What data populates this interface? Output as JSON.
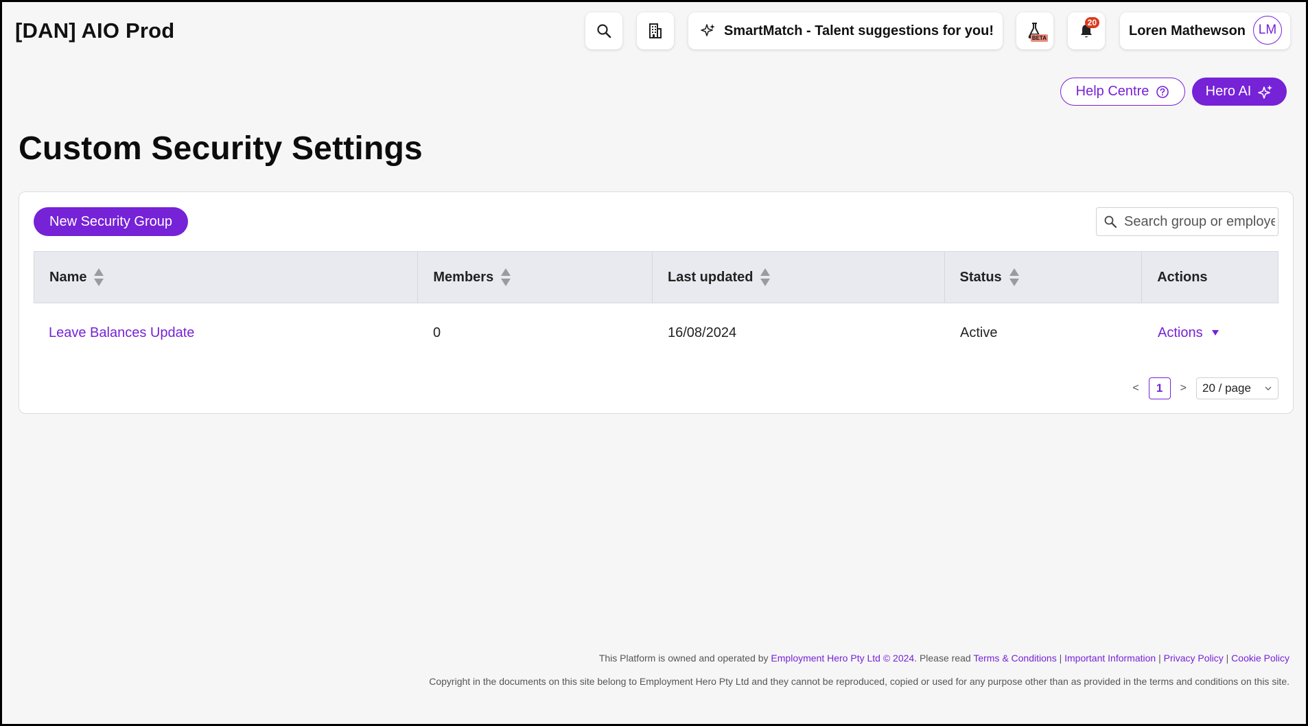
{
  "header": {
    "org_title": "[DAN] AIO Prod",
    "smartmatch_label": "SmartMatch - Talent suggestions for you!",
    "beta_label": "BETA",
    "notification_count": "20",
    "user_name": "Loren Mathewson",
    "user_initials": "LM"
  },
  "actions_bar": {
    "help_label": "Help Centre",
    "hero_ai_label": "Hero AI"
  },
  "page": {
    "title": "Custom Security Settings"
  },
  "toolbar": {
    "new_group_label": "New Security Group",
    "search_placeholder": "Search group or employee"
  },
  "table": {
    "columns": [
      "Name",
      "Members",
      "Last updated",
      "Status",
      "Actions"
    ],
    "rows": [
      {
        "name": "Leave Balances Update",
        "members": "0",
        "last_updated": "16/08/2024",
        "status": "Active",
        "actions_label": "Actions"
      }
    ]
  },
  "pagination": {
    "prev": "<",
    "current_page": "1",
    "next": ">",
    "page_size": "20 / page"
  },
  "footer": {
    "line1_prefix": "This Platform is owned and operated by ",
    "owner_link": "Employment Hero Pty Ltd © 2024",
    "line1_mid": ". Please read ",
    "terms_link": "Terms & Conditions",
    "sep": " | ",
    "important_link": "Important Information",
    "privacy_link": "Privacy Policy",
    "cookie_link": "Cookie Policy",
    "line2": "Copyright in the documents on this site belong to Employment Hero Pty Ltd and they cannot be reproduced, copied or used for any purpose other than as provided in the terms and conditions on this site."
  },
  "colors": {
    "accent": "#7622d7",
    "header_bg": "#e9eaf0",
    "badge": "#d93b1e"
  }
}
